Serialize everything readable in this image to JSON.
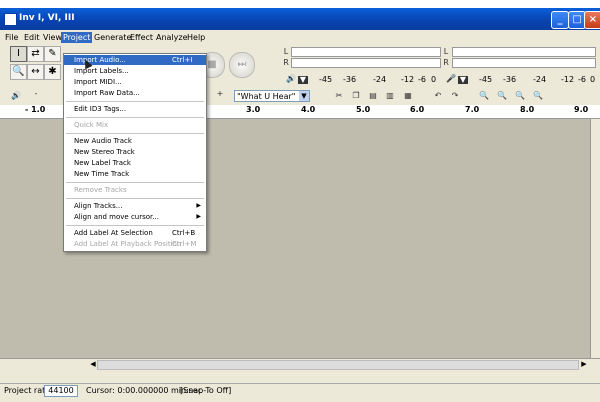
{
  "window": {
    "title": "Inv I, VI, III"
  },
  "menubar": [
    "File",
    "Edit",
    "View",
    "Project",
    "Generate",
    "Effect",
    "Analyze",
    "Help"
  ],
  "toolbar": {
    "tools": [
      "I",
      "↔",
      "✱",
      "🔍",
      "✎",
      "⇄"
    ],
    "meter_L": "L",
    "meter_R": "R",
    "meter_scale_play": [
      "-45",
      "-36",
      "-24",
      "-12",
      "-6",
      "0"
    ],
    "meter_scale_rec": [
      "-45",
      "-36",
      "-24",
      "-12",
      "-6",
      "0"
    ],
    "minus": "-",
    "plus": "+",
    "input_source": "\"What U Hear\""
  },
  "ruler": {
    "ticks": [
      "- 1.0",
      "3.0",
      "4.0",
      "5.0",
      "6.0",
      "7.0",
      "8.0",
      "9.0"
    ]
  },
  "project_menu": {
    "items": [
      {
        "label": "Import Audio...",
        "shortcut": "Ctrl+I",
        "state": "highlighted"
      },
      {
        "label": "Import Labels...",
        "shortcut": "",
        "state": "enabled"
      },
      {
        "label": "Import MIDI...",
        "shortcut": "",
        "state": "enabled"
      },
      {
        "label": "Import Raw Data...",
        "shortcut": "",
        "state": "enabled"
      },
      {
        "label": "Edit ID3 Tags...",
        "shortcut": "",
        "state": "enabled"
      },
      {
        "label": "Quick Mix",
        "shortcut": "",
        "state": "disabled"
      },
      {
        "label": "New Audio Track",
        "shortcut": "",
        "state": "enabled"
      },
      {
        "label": "New Stereo Track",
        "shortcut": "",
        "state": "enabled"
      },
      {
        "label": "New Label Track",
        "shortcut": "",
        "state": "enabled"
      },
      {
        "label": "New Time Track",
        "shortcut": "",
        "state": "enabled"
      },
      {
        "label": "Remove Tracks",
        "shortcut": "",
        "state": "disabled"
      },
      {
        "label": "Align Tracks...",
        "shortcut": "",
        "state": "submenu"
      },
      {
        "label": "Align and move cursor...",
        "shortcut": "",
        "state": "submenu"
      },
      {
        "label": "Add Label At Selection",
        "shortcut": "Ctrl+B",
        "state": "enabled"
      },
      {
        "label": "Add Label At Playback Position",
        "shortcut": "Ctrl+M",
        "state": "disabled"
      }
    ]
  },
  "statusbar": {
    "rate_label": "Project rate:",
    "rate_value": "44100",
    "cursor": "Cursor: 0:00.000000 min:sec",
    "snap": "[Snap-To Off]"
  },
  "colors": {
    "titlebar": "#0842b0",
    "highlight": "#316ac5",
    "chrome": "#ece9d8",
    "track_area": "#c0bcad"
  }
}
